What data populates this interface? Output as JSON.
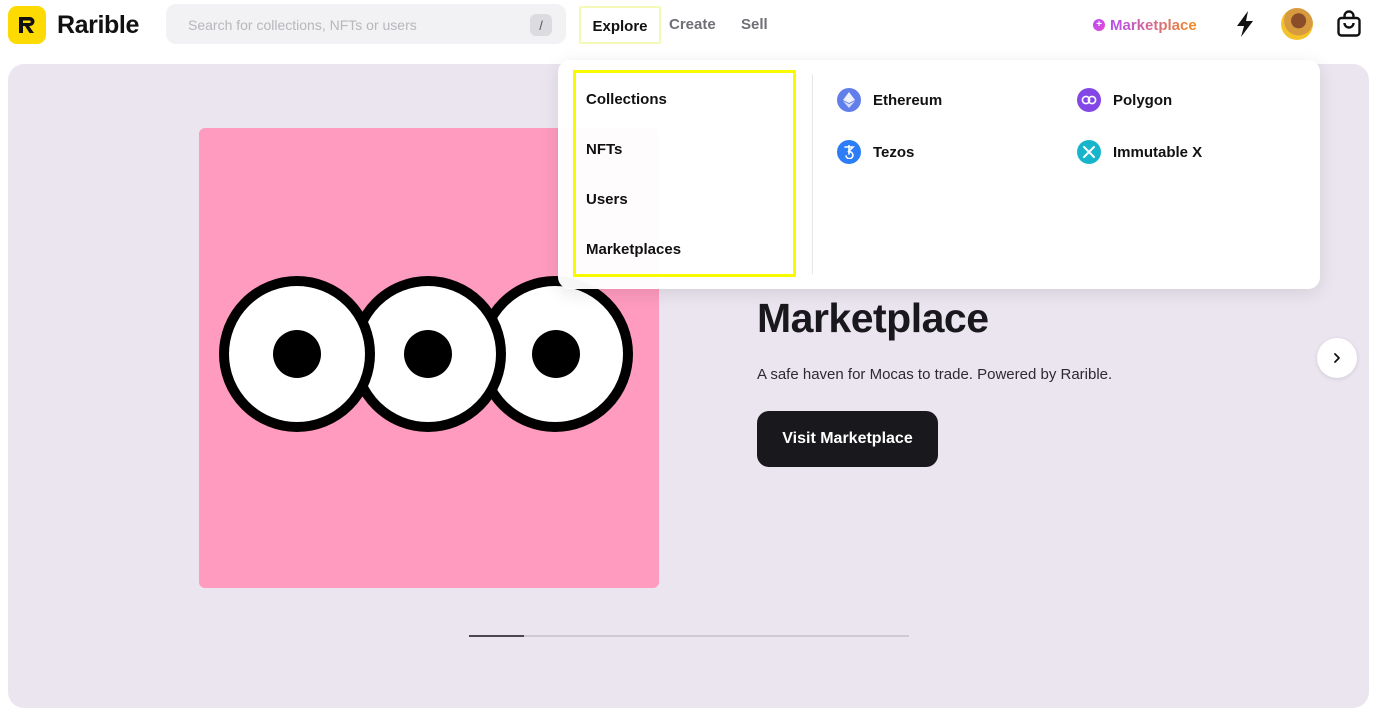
{
  "header": {
    "logo_text": "Rarible",
    "search": {
      "placeholder": "Search for collections, NFTs or users",
      "value": "",
      "shortcut": "/"
    },
    "nav": {
      "explore": "Explore",
      "create": "Create",
      "sell": "Sell"
    },
    "marketplace_link": "Marketplace",
    "icons": [
      "lightning-icon",
      "avatar",
      "shopping-bag-icon"
    ]
  },
  "dropdown": {
    "left_items": [
      "Collections",
      "NFTs",
      "Users",
      "Marketplaces"
    ],
    "chains": [
      {
        "label": "Ethereum",
        "color": "#627EEA"
      },
      {
        "label": "Polygon",
        "color": "#8247E5"
      },
      {
        "label": "Tezos",
        "color": "#2C7DF7"
      },
      {
        "label": "Immutable X",
        "color": "#17B5CB"
      }
    ]
  },
  "hero": {
    "title": "Marketplace",
    "description": "A safe haven for Mocas to trade. Powered by Rarible.",
    "button_label": "Visit Marketplace",
    "art_color": "#FE9BBE",
    "carousel_progress": 0.125
  },
  "colors": {
    "brand_yellow": "#FEDA03",
    "highlight": "#F9F900",
    "hero_bg": "#EBE5F0",
    "dark": "#19181C"
  }
}
